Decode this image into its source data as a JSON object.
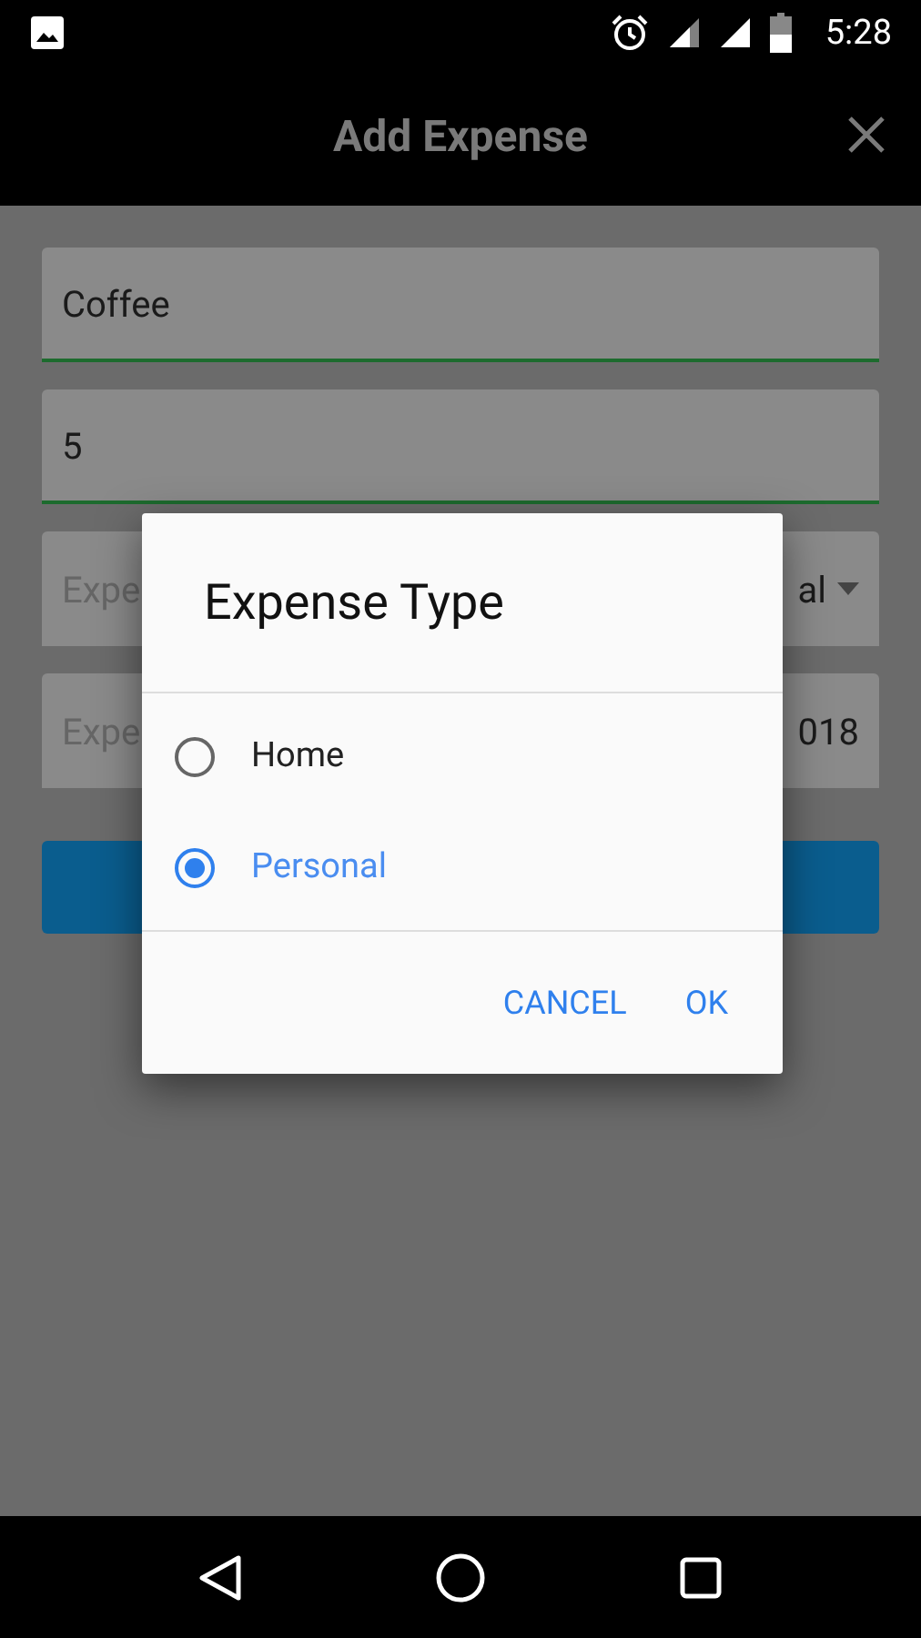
{
  "status_bar": {
    "time": "5:28"
  },
  "app_bar": {
    "title": "Add Expense"
  },
  "fields": [
    {
      "kind": "text",
      "value": "Coffee"
    },
    {
      "kind": "text",
      "value": "5"
    },
    {
      "kind": "dropdown",
      "placeholder": "Expe",
      "value": "al"
    },
    {
      "kind": "text",
      "placeholder": "Expe",
      "value": "018"
    }
  ],
  "dialog": {
    "title": "Expense Type",
    "options": [
      {
        "label": "Home",
        "selected": false
      },
      {
        "label": "Personal",
        "selected": true
      }
    ],
    "buttons": [
      "CANCEL",
      "OK"
    ]
  }
}
